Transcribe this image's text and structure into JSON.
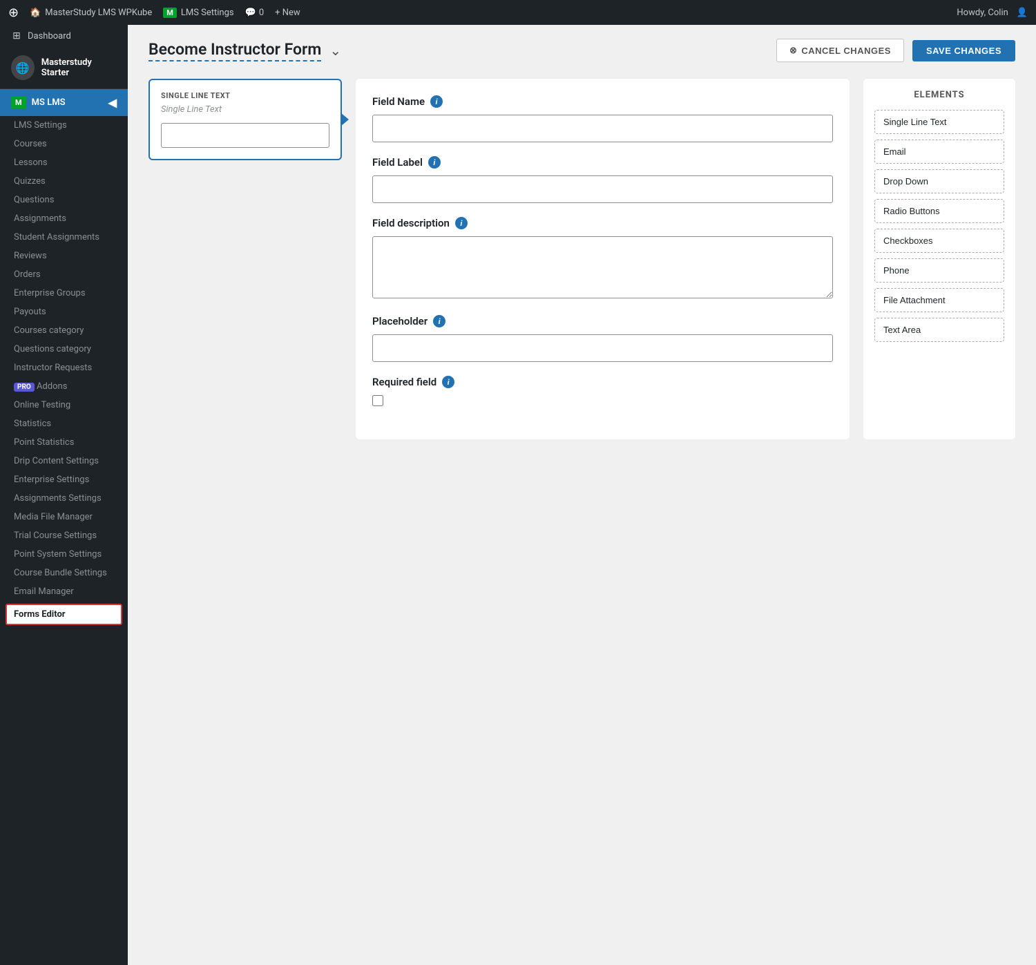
{
  "admin_bar": {
    "wp_icon": "⊕",
    "site_name": "MasterStudy LMS WPKube",
    "lms_label": "M",
    "lms_settings": "LMS Settings",
    "comments_icon": "💬",
    "comments_count": "0",
    "new_label": "+ New",
    "howdy": "Howdy, Colin"
  },
  "sidebar": {
    "user_name": "Masterstudy Starter",
    "user_icon": "🌐",
    "dashboard_label": "Dashboard",
    "ms_lms_label": "MS LMS",
    "ms_badge": "M",
    "items": [
      {
        "id": "lms-settings",
        "label": "LMS Settings"
      },
      {
        "id": "courses",
        "label": "Courses"
      },
      {
        "id": "lessons",
        "label": "Lessons"
      },
      {
        "id": "quizzes",
        "label": "Quizzes"
      },
      {
        "id": "questions",
        "label": "Questions"
      },
      {
        "id": "assignments",
        "label": "Assignments"
      },
      {
        "id": "student-assignments",
        "label": "Student Assignments"
      },
      {
        "id": "reviews",
        "label": "Reviews"
      },
      {
        "id": "orders",
        "label": "Orders"
      },
      {
        "id": "enterprise-groups",
        "label": "Enterprise Groups"
      },
      {
        "id": "payouts",
        "label": "Payouts"
      },
      {
        "id": "courses-category",
        "label": "Courses category"
      },
      {
        "id": "questions-category",
        "label": "Questions category"
      },
      {
        "id": "instructor-requests",
        "label": "Instructor Requests"
      },
      {
        "id": "addons",
        "label": "Addons",
        "pro": true
      },
      {
        "id": "online-testing",
        "label": "Online Testing"
      },
      {
        "id": "statistics",
        "label": "Statistics"
      },
      {
        "id": "point-statistics",
        "label": "Point Statistics"
      },
      {
        "id": "drip-content-settings",
        "label": "Drip Content Settings"
      },
      {
        "id": "enterprise-settings",
        "label": "Enterprise Settings"
      },
      {
        "id": "assignments-settings",
        "label": "Assignments Settings"
      },
      {
        "id": "media-file-manager",
        "label": "Media File Manager"
      },
      {
        "id": "trial-course-settings",
        "label": "Trial Course Settings"
      },
      {
        "id": "point-system-settings",
        "label": "Point System Settings"
      },
      {
        "id": "course-bundle-settings",
        "label": "Course Bundle Settings"
      },
      {
        "id": "email-manager",
        "label": "Email Manager"
      },
      {
        "id": "forms-editor",
        "label": "Forms Editor",
        "active": true,
        "highlighted": true
      }
    ]
  },
  "page": {
    "title": "Become Instructor Form",
    "cancel_button": "CANCEL CHANGES",
    "save_button": "SAVE CHANGES"
  },
  "form_preview": {
    "element_type": "SINGLE LINE TEXT",
    "element_name": "Single Line Text"
  },
  "field_settings": {
    "field_name_label": "Field Name",
    "field_label_label": "Field Label",
    "field_description_label": "Field description",
    "placeholder_label": "Placeholder",
    "required_field_label": "Required field"
  },
  "elements_panel": {
    "title": "ELEMENTS",
    "items": [
      "Single Line Text",
      "Email",
      "Drop Down",
      "Radio Buttons",
      "Checkboxes",
      "Phone",
      "File Attachment",
      "Text Area"
    ]
  }
}
